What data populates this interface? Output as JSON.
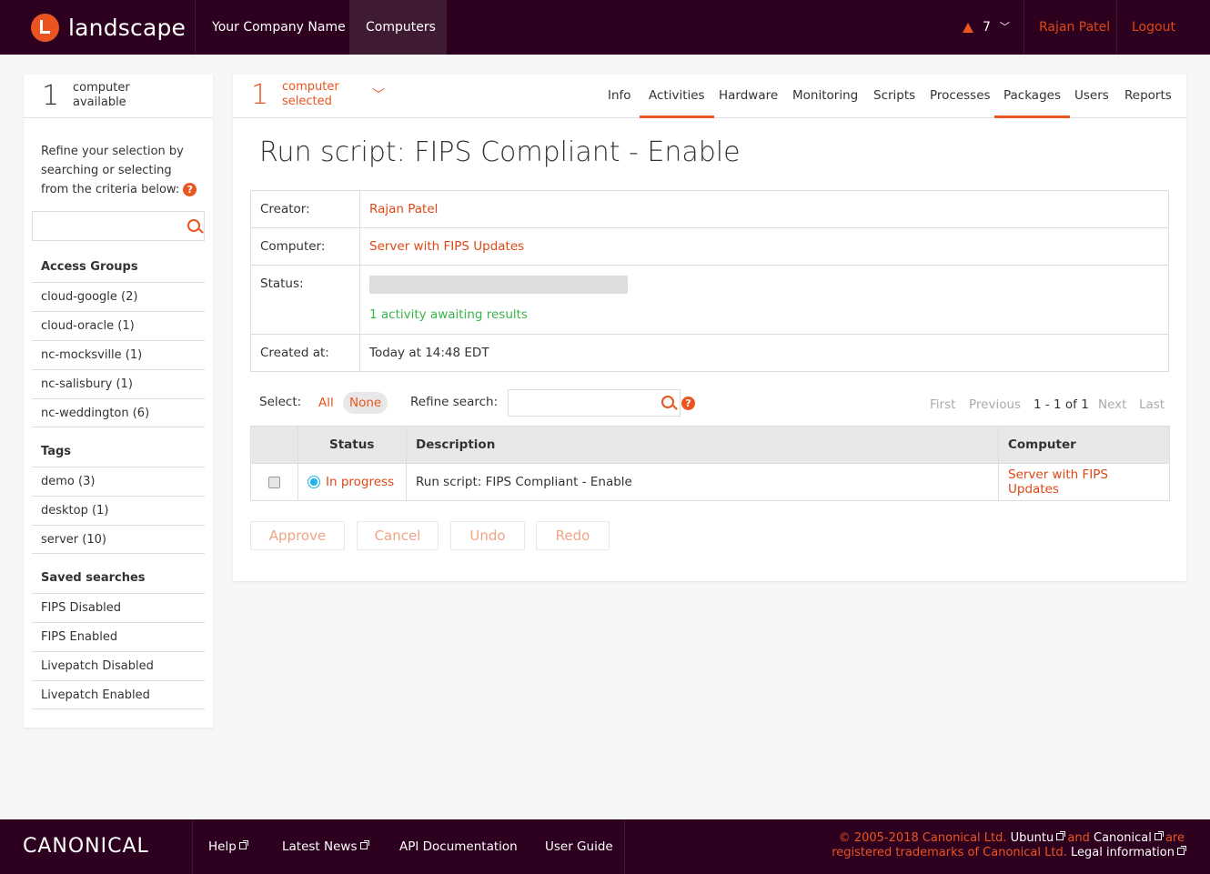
{
  "header": {
    "logo_text": "landscape",
    "org_name": "Your Company Name",
    "nav_computers": "Computers",
    "alert_count": "7",
    "user_name": "Rajan Patel",
    "logout": "Logout"
  },
  "sidebar": {
    "count": "1",
    "count_label_1": "computer",
    "count_label_2": "available",
    "refine_text": "Refine your selection by searching or selecting from the criteria below:",
    "help": "?",
    "search_placeholder": "",
    "access_groups_title": "Access Groups",
    "access_groups": [
      "cloud-google (2)",
      "cloud-oracle (1)",
      "nc-mocksville (1)",
      "nc-salisbury (1)",
      "nc-weddington (6)"
    ],
    "tags_title": "Tags",
    "tags": [
      "demo (3)",
      "desktop (1)",
      "server (10)"
    ],
    "saved_title": "Saved searches",
    "saved": [
      "FIPS Disabled",
      "FIPS Enabled",
      "Livepatch Disabled",
      "Livepatch Enabled"
    ]
  },
  "selection": {
    "count": "1",
    "label_1": "computer",
    "label_2": "selected"
  },
  "tabs": [
    "Info",
    "Activities",
    "Hardware",
    "Monitoring",
    "Scripts",
    "Processes",
    "Packages",
    "Users",
    "Reports"
  ],
  "page_title": "Run script: FIPS Compliant - Enable",
  "details": {
    "creator_label": "Creator:",
    "creator": "Rajan Patel",
    "computer_label": "Computer:",
    "computer": "Server with FIPS Updates",
    "status_label": "Status:",
    "progress_fraction": 0,
    "status_text": "1 activity awaiting results",
    "created_label": "Created at:",
    "created": "Today at 14:48 EDT"
  },
  "filter": {
    "select_label": "Select:",
    "all": "All",
    "none": "None",
    "refine_label": "Refine search:",
    "help": "?",
    "first": "First",
    "previous": "Previous",
    "range": "1 - 1 of 1",
    "next": "Next",
    "last": "Last"
  },
  "activities": {
    "headers": {
      "status": "Status",
      "description": "Description",
      "computer": "Computer"
    },
    "rows": [
      {
        "status": "In progress",
        "description": "Run script: FIPS Compliant - Enable",
        "computer": "Server with FIPS Updates"
      }
    ]
  },
  "buttons": {
    "approve": "Approve",
    "cancel": "Cancel",
    "undo": "Undo",
    "redo": "Redo"
  },
  "footer": {
    "brand": "CANONICAL",
    "help": "Help",
    "news": "Latest News",
    "api": "API Documentation",
    "guide": "User Guide",
    "copy_1": "© 2005-2018 Canonical Ltd.",
    "ubuntu": "Ubuntu",
    "and": "and",
    "canonical": "Canonical",
    "are": "are",
    "copy_2": "registered trademarks of Canonical Ltd.",
    "legal": "Legal information"
  },
  "colors": {
    "brand_dark": "#2c001e",
    "accent": "#e95420",
    "success": "#38b44a",
    "info": "#19b6ee"
  }
}
